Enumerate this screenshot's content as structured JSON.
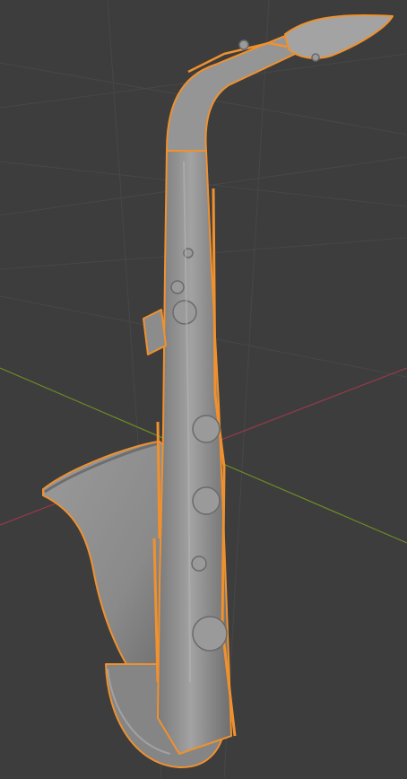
{
  "viewport": {
    "view": "3d-viewport",
    "background_color": "#3d3d3d",
    "grid_color": "#474747",
    "x_axis_color": "#9b3a49",
    "y_axis_color": "#6b8e23"
  },
  "object": {
    "name": "saxophone",
    "selected": true,
    "shading": "solid",
    "body_color": "#8e8e8e",
    "selection_outline_color": "#f0912e"
  }
}
